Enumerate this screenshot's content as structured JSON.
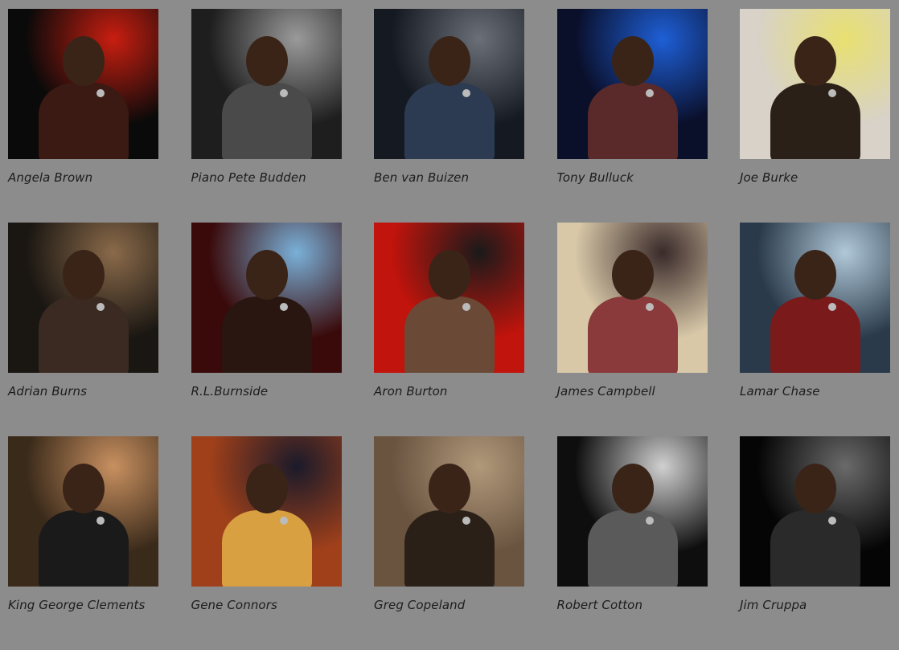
{
  "artists": [
    {
      "name": "Angela Brown",
      "photo": "singer-red-dress-photo",
      "palette": [
        "#0a0a0a",
        "#c81e10",
        "#3a1a12"
      ]
    },
    {
      "name": "Piano Pete Budden",
      "photo": "pianist-black-white-photo",
      "palette": [
        "#1e1e1e",
        "#9a9a9a",
        "#4a4a4a"
      ]
    },
    {
      "name": "Ben van Buizen",
      "photo": "band-stage-photo",
      "palette": [
        "#151a22",
        "#6b6f78",
        "#2c3b52"
      ]
    },
    {
      "name": "Tony Bulluck",
      "photo": "guitarist-blue-light-photo",
      "palette": [
        "#0a0f2a",
        "#1e5fd6",
        "#5a2a2a"
      ]
    },
    {
      "name": "Joe Burke",
      "photo": "singer-yellow-jacket-photo",
      "palette": [
        "#d8d2c8",
        "#e8e070",
        "#2a2018"
      ]
    },
    {
      "name": "Adrian Burns",
      "photo": "guitarist-pub-photo",
      "palette": [
        "#1a1612",
        "#8a6a4a",
        "#3a2a22"
      ]
    },
    {
      "name": "R.L.Burnside",
      "photo": "guitarist-red-stage-photo",
      "palette": [
        "#3a0a0a",
        "#7ab0d8",
        "#2a1610"
      ]
    },
    {
      "name": "Aron Burton",
      "photo": "singer-cowboy-hat-photo",
      "palette": [
        "#c0140c",
        "#1a1a1a",
        "#6a4a36"
      ]
    },
    {
      "name": "James Campbell",
      "photo": "band-group-photo",
      "palette": [
        "#d8c8a8",
        "#3a2a2a",
        "#8a3a3a"
      ]
    },
    {
      "name": "Lamar Chase",
      "photo": "guitarist-red-guitar-photo",
      "palette": [
        "#2a3a4a",
        "#b0c8d8",
        "#7a1a1a"
      ]
    },
    {
      "name": "King George Clements",
      "photo": "band-bar-photo",
      "palette": [
        "#3a2a1a",
        "#c89060",
        "#1a1a1a"
      ]
    },
    {
      "name": "Gene Connors",
      "photo": "trombonist-photo",
      "palette": [
        "#a0401a",
        "#1a1a2a",
        "#d8a040"
      ]
    },
    {
      "name": "Greg Copeland",
      "photo": "singer-hat-sepia-photo",
      "palette": [
        "#6a5440",
        "#b0987a",
        "#2a2018"
      ]
    },
    {
      "name": "Robert Cotton",
      "photo": "duo-guitars-bw-photo",
      "palette": [
        "#0e0e0e",
        "#d0d0d0",
        "#5a5a5a"
      ]
    },
    {
      "name": "Jim Cruppa",
      "photo": "singer-bw-photo",
      "palette": [
        "#050505",
        "#6a6a6a",
        "#2a2a2a"
      ]
    }
  ]
}
